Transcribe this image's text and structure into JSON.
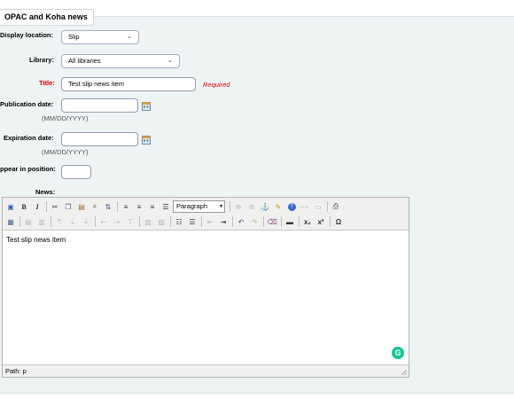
{
  "fieldset": {
    "legend": "OPAC and Koha news"
  },
  "form": {
    "display_location": {
      "label": "Display location:",
      "value": "Slip"
    },
    "library": {
      "label": "Library:",
      "value": "All libraries"
    },
    "title": {
      "label": "Title:",
      "value": "Test slip news item",
      "required_text": "Required"
    },
    "publication_date": {
      "label": "Publication date:",
      "value": "",
      "hint": "(MM/DD/YYYY)"
    },
    "expiration_date": {
      "label": "Expiration date:",
      "value": "",
      "hint": "(MM/DD/YYYY)"
    },
    "position": {
      "label": "ppear in position:",
      "value": ""
    },
    "news": {
      "label": "News:"
    }
  },
  "editor": {
    "format_select": "Paragraph",
    "content": "Test slip news item",
    "path": "Path: p",
    "grammarly": "G"
  },
  "colors": {
    "required": "#cc0000",
    "fieldset_bg": "#eef3f4",
    "grammarly": "#15c39a"
  }
}
